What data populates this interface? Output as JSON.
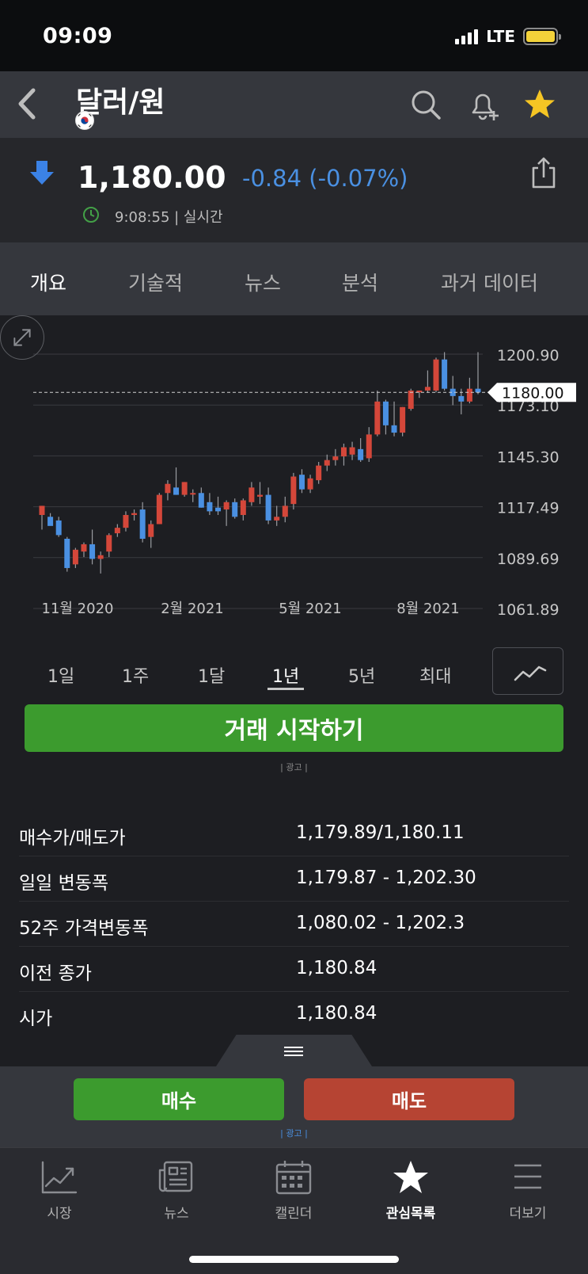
{
  "status": {
    "time": "09:09",
    "network": "LTE"
  },
  "header": {
    "title": "달러/원",
    "icons": [
      "back-icon",
      "flag-icon",
      "search-icon",
      "bell-plus-icon",
      "star-icon"
    ]
  },
  "quote": {
    "price": "1,180.00",
    "change": "-0.84 (-0.07%)",
    "time": "9:08:55 | 실시간",
    "direction": "down",
    "change_color": "#4a90e2"
  },
  "tabs": [
    {
      "label": "개요",
      "active": true
    },
    {
      "label": "기술적"
    },
    {
      "label": "뉴스"
    },
    {
      "label": "분석"
    },
    {
      "label": "과거 데이터"
    }
  ],
  "chart_data": {
    "type": "candlestick",
    "x_tick_labels": [
      "11월 2020",
      "2월 2021",
      "5월 2021",
      "8월 2021"
    ],
    "y_tick_labels": [
      "1200.90",
      "1173.10",
      "1145.30",
      "1117.49",
      "1089.69",
      "1061.89"
    ],
    "ylim": [
      1061.89,
      1200.9
    ],
    "current_price_label": "1180.00",
    "current_price": 1180.0,
    "up_color": "#d4473a",
    "down_color": "#4a90e2",
    "candles": [
      {
        "o": 1113,
        "h": 1118,
        "l": 1105,
        "c": 1118
      },
      {
        "o": 1112,
        "h": 1114,
        "l": 1108,
        "c": 1107
      },
      {
        "o": 1110,
        "h": 1112,
        "l": 1101,
        "c": 1102
      },
      {
        "o": 1100,
        "h": 1101,
        "l": 1082,
        "c": 1084
      },
      {
        "o": 1086,
        "h": 1095,
        "l": 1084,
        "c": 1094
      },
      {
        "o": 1093,
        "h": 1098,
        "l": 1090,
        "c": 1097
      },
      {
        "o": 1097,
        "h": 1105,
        "l": 1086,
        "c": 1089
      },
      {
        "o": 1089,
        "h": 1093,
        "l": 1081,
        "c": 1091
      },
      {
        "o": 1093,
        "h": 1103,
        "l": 1090,
        "c": 1102
      },
      {
        "o": 1103,
        "h": 1108,
        "l": 1101,
        "c": 1106
      },
      {
        "o": 1106,
        "h": 1115,
        "l": 1104,
        "c": 1113
      },
      {
        "o": 1113,
        "h": 1116,
        "l": 1110,
        "c": 1114
      },
      {
        "o": 1116,
        "h": 1120,
        "l": 1098,
        "c": 1100
      },
      {
        "o": 1101,
        "h": 1110,
        "l": 1095,
        "c": 1108
      },
      {
        "o": 1108,
        "h": 1125,
        "l": 1108,
        "c": 1124
      },
      {
        "o": 1125,
        "h": 1132,
        "l": 1121,
        "c": 1130
      },
      {
        "o": 1128,
        "h": 1139,
        "l": 1124,
        "c": 1124
      },
      {
        "o": 1124,
        "h": 1131,
        "l": 1123,
        "c": 1131
      },
      {
        "o": 1125,
        "h": 1127,
        "l": 1120,
        "c": 1125
      },
      {
        "o": 1125,
        "h": 1128,
        "l": 1117,
        "c": 1117
      },
      {
        "o": 1120,
        "h": 1125,
        "l": 1113,
        "c": 1115
      },
      {
        "o": 1117,
        "h": 1123,
        "l": 1113,
        "c": 1115
      },
      {
        "o": 1116,
        "h": 1121,
        "l": 1107,
        "c": 1120
      },
      {
        "o": 1120,
        "h": 1122,
        "l": 1111,
        "c": 1112
      },
      {
        "o": 1113,
        "h": 1122,
        "l": 1110,
        "c": 1121
      },
      {
        "o": 1120,
        "h": 1131,
        "l": 1118,
        "c": 1128
      },
      {
        "o": 1123,
        "h": 1131,
        "l": 1119,
        "c": 1124
      },
      {
        "o": 1124,
        "h": 1128,
        "l": 1108,
        "c": 1110
      },
      {
        "o": 1110,
        "h": 1118,
        "l": 1107,
        "c": 1112
      },
      {
        "o": 1112,
        "h": 1123,
        "l": 1109,
        "c": 1118
      },
      {
        "o": 1119,
        "h": 1136,
        "l": 1116,
        "c": 1134
      },
      {
        "o": 1135,
        "h": 1138,
        "l": 1125,
        "c": 1127
      },
      {
        "o": 1127,
        "h": 1135,
        "l": 1125,
        "c": 1133
      },
      {
        "o": 1132,
        "h": 1142,
        "l": 1130,
        "c": 1140
      },
      {
        "o": 1140,
        "h": 1146,
        "l": 1137,
        "c": 1143
      },
      {
        "o": 1143,
        "h": 1149,
        "l": 1140,
        "c": 1145
      },
      {
        "o": 1145,
        "h": 1152,
        "l": 1140,
        "c": 1150
      },
      {
        "o": 1146,
        "h": 1153,
        "l": 1143,
        "c": 1150
      },
      {
        "o": 1149,
        "h": 1155,
        "l": 1142,
        "c": 1143
      },
      {
        "o": 1144,
        "h": 1161,
        "l": 1142,
        "c": 1157
      },
      {
        "o": 1157,
        "h": 1181,
        "l": 1156,
        "c": 1175
      },
      {
        "o": 1175,
        "h": 1176,
        "l": 1157,
        "c": 1162
      },
      {
        "o": 1162,
        "h": 1175,
        "l": 1156,
        "c": 1158
      },
      {
        "o": 1158,
        "h": 1172,
        "l": 1156,
        "c": 1172
      },
      {
        "o": 1171,
        "h": 1182,
        "l": 1170,
        "c": 1181
      },
      {
        "o": 1180,
        "h": 1181,
        "l": 1177,
        "c": 1181
      },
      {
        "o": 1181,
        "h": 1192,
        "l": 1180,
        "c": 1183
      },
      {
        "o": 1181,
        "h": 1199,
        "l": 1180,
        "c": 1198
      },
      {
        "o": 1198,
        "h": 1202,
        "l": 1181,
        "c": 1182
      },
      {
        "o": 1182,
        "h": 1189,
        "l": 1173,
        "c": 1178
      },
      {
        "o": 1178,
        "h": 1182,
        "l": 1168,
        "c": 1175
      },
      {
        "o": 1175,
        "h": 1188,
        "l": 1174,
        "c": 1182
      },
      {
        "o": 1182,
        "h": 1202,
        "l": 1179,
        "c": 1180
      }
    ]
  },
  "ranges": [
    {
      "label": "1일"
    },
    {
      "label": "1주"
    },
    {
      "label": "1달"
    },
    {
      "label": "1년",
      "active": true
    },
    {
      "label": "5년"
    },
    {
      "label": "최대"
    }
  ],
  "cta": {
    "label": "거래 시작하기",
    "ad": "| 광고 |"
  },
  "stats": [
    {
      "label": "매수가/매도가",
      "value": "1,179.89/1,180.11"
    },
    {
      "label": "일일 변동폭",
      "value": "1,179.87 - 1,202.30"
    },
    {
      "label": "52주 가격변동폭",
      "value": "1,080.02 - 1,202.3"
    },
    {
      "label": "이전 종가",
      "value": "1,180.84"
    },
    {
      "label": "시가",
      "value": "1,180.84"
    }
  ],
  "trade": {
    "buy": "매수",
    "sell": "매도",
    "ad": "| 광고 |"
  },
  "nav": [
    {
      "label": "시장",
      "icon": "chart-icon"
    },
    {
      "label": "뉴스",
      "icon": "news-icon"
    },
    {
      "label": "캘린더",
      "icon": "calendar-icon"
    },
    {
      "label": "관심목록",
      "icon": "star-icon",
      "active": true
    },
    {
      "label": "더보기",
      "icon": "menu-icon"
    }
  ]
}
